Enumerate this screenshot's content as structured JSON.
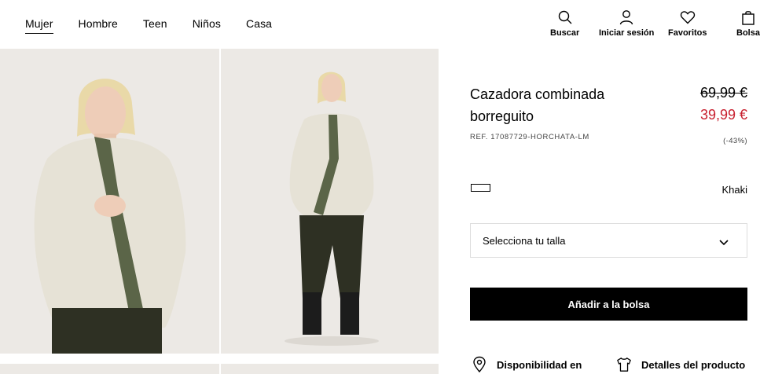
{
  "nav": {
    "items": [
      {
        "label": "Mujer",
        "active": true
      },
      {
        "label": "Hombre",
        "active": false
      },
      {
        "label": "Teen",
        "active": false
      },
      {
        "label": "Niños",
        "active": false
      },
      {
        "label": "Casa",
        "active": false
      }
    ]
  },
  "header_actions": {
    "search": {
      "label": "Buscar",
      "icon": "search-icon"
    },
    "login": {
      "label": "Iniciar sesión",
      "icon": "user-icon"
    },
    "favorites": {
      "label": "Favoritos",
      "icon": "heart-icon"
    },
    "bag": {
      "label": "Bolsa",
      "icon": "bag-icon"
    }
  },
  "product": {
    "title": "Cazadora combinada borreguito",
    "price_old": "69,99 €",
    "price_new": "39,99 €",
    "ref": "REF. 17087729-HORCHATA-LM",
    "discount": "(-43%)",
    "color_name": "Khaki",
    "size_placeholder": "Selecciona tu talla",
    "add_to_bag": "Añadir a la bolsa",
    "availability": "Disponibilidad en",
    "details": "Detalles del producto"
  },
  "colors": {
    "price_sale": "#c8202f",
    "button_bg": "#000000",
    "photo_bg": "#ece9e5",
    "jacket": "#e6e2d6",
    "jacket_trim": "#5b6548",
    "trousers": "#2e3023"
  }
}
